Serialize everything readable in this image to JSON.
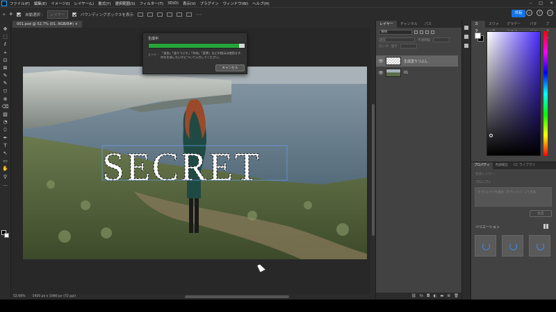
{
  "menu": {
    "items": [
      "ファイル(F)",
      "編集(E)",
      "イメージ(I)",
      "レイヤー(L)",
      "書式(Y)",
      "選択範囲(S)",
      "フィルター(T)",
      "3D(D)",
      "表示(V)",
      "プラグイン",
      "ウィンドウ(W)",
      "ヘルプ(H)"
    ]
  },
  "options": {
    "auto_select": "自動選択 :",
    "layer": "レイヤー",
    "bounding_box": "バウンディングボックスを表示",
    "more": "･･･"
  },
  "header": {
    "share": "共有"
  },
  "tools": [
    "✥",
    "⬚",
    "ℓ",
    "⌖",
    "⊡",
    "⊠",
    "✎",
    "✎",
    "⛉",
    "⊕",
    "⌫",
    "▨",
    "◔",
    "⬯",
    "✒",
    "T",
    "↖",
    "▭",
    "✋",
    "⚲",
    "…"
  ],
  "document": {
    "tab": "001.psd @ 52.7% (01, RGB/8#) ×",
    "status_zoom": "52.66%",
    "status_size": "1920 px x 1080 px (72 ppi)"
  },
  "canvas": {
    "text": "SECRET"
  },
  "dialog": {
    "title": "生成中",
    "progress_percent": 94,
    "hint_label": "ヒント :",
    "hint": "「追加」「塗りつぶす」「作成」「変更」などの指示は使用せず、何を生成したいかについて入力してください。",
    "cancel": "キャンセル"
  },
  "layers": {
    "tabs": [
      "レイヤー",
      "チャンネル",
      "パス"
    ],
    "search": "種類",
    "blend": "通常",
    "opacity_label": "不透明度",
    "fill_label": "塗り",
    "lock_label": "ロック",
    "items": [
      {
        "name": "生成塗りつぶし"
      },
      {
        "name": "01"
      }
    ]
  },
  "right": {
    "tabs": [
      "カラー",
      "スウォッチ",
      "グラデーション",
      "パターン",
      "ブラシ"
    ]
  },
  "properties": {
    "tabs": [
      "プロパティ",
      "色調補正",
      "CC ライブラリ"
    ],
    "layer_type": "生成レイヤー",
    "prompt_label": "プロンプト",
    "prompt_placeholder": "オブジェクトを追加（オプション）して生成",
    "generate": "生成",
    "variations_label": "バリエーション"
  }
}
